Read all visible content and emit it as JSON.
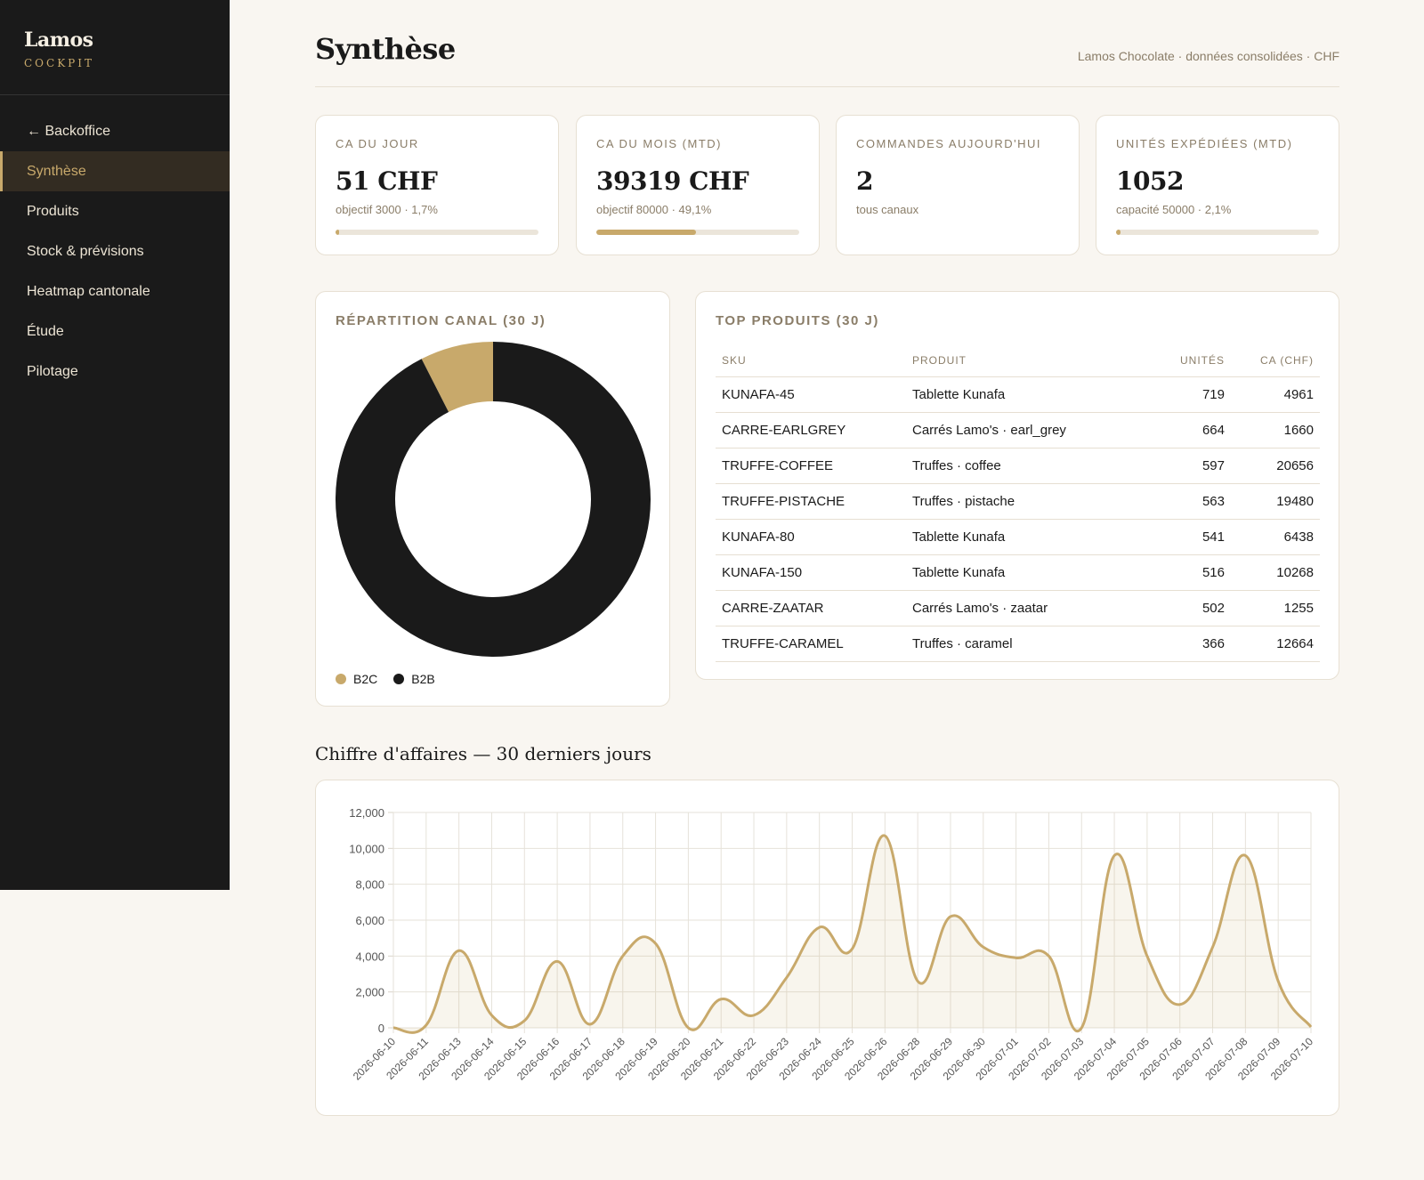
{
  "sidebar": {
    "brand": "Lamos",
    "brand_sub": "COCKPIT",
    "items": [
      {
        "label": "← Backoffice",
        "active": false
      },
      {
        "label": "Synthèse",
        "active": true
      },
      {
        "label": "Produits",
        "active": false
      },
      {
        "label": "Stock & prévisions",
        "active": false
      },
      {
        "label": "Heatmap cantonale",
        "active": false
      },
      {
        "label": "Étude",
        "active": false
      },
      {
        "label": "Pilotage",
        "active": false
      }
    ]
  },
  "header": {
    "title": "Synthèse",
    "meta": "Lamos Chocolate · données consolidées · CHF"
  },
  "kpis": [
    {
      "label": "CA du jour",
      "value": "51 CHF",
      "sub": "objectif 3000 · 1,7%",
      "progress": 0.017
    },
    {
      "label": "CA du mois (MTD)",
      "value": "39319 CHF",
      "sub": "objectif 80000 · 49,1%",
      "progress": 0.491
    },
    {
      "label": "Commandes aujourd'hui",
      "value": "2",
      "sub": "tous canaux",
      "progress": null
    },
    {
      "label": "Unités expédiées (MTD)",
      "value": "1052",
      "sub": "capacité 50000 · 2,1%",
      "progress": 0.021
    }
  ],
  "channel": {
    "title": "Répartition canal (30 j)",
    "chart_data": {
      "type": "pie",
      "labels": [
        "B2C",
        "B2B"
      ],
      "values": [
        7.5,
        92.5
      ],
      "colors": [
        "#c8a96b",
        "#1a1a1a"
      ],
      "legend": "bottom-left"
    },
    "legend": [
      {
        "label": "B2C",
        "color": "#c8a96b"
      },
      {
        "label": "B2B",
        "color": "#1a1a1a"
      }
    ]
  },
  "top_products": {
    "title": "Top produits (30 j)",
    "columns": [
      "SKU",
      "Produit",
      "Unités",
      "CA (CHF)"
    ],
    "rows": [
      [
        "KUNAFA-45",
        "Tablette Kunafa",
        "719",
        "4961"
      ],
      [
        "CARRE-EARLGREY",
        "Carrés Lamo's · earl_grey",
        "664",
        "1660"
      ],
      [
        "TRUFFE-COFFEE",
        "Truffes · coffee",
        "597",
        "20656"
      ],
      [
        "TRUFFE-PISTACHE",
        "Truffes · pistache",
        "563",
        "19480"
      ],
      [
        "KUNAFA-80",
        "Tablette Kunafa",
        "541",
        "6438"
      ],
      [
        "KUNAFA-150",
        "Tablette Kunafa",
        "516",
        "10268"
      ],
      [
        "CARRE-ZAATAR",
        "Carrés Lamo's · zaatar",
        "502",
        "1255"
      ],
      [
        "TRUFFE-CARAMEL",
        "Truffes · caramel",
        "366",
        "12664"
      ]
    ]
  },
  "revenue": {
    "title": "Chiffre d'affaires — 30 derniers jours",
    "chart_data": {
      "type": "area",
      "x": [
        "2026-06-10",
        "2026-06-11",
        "2026-06-13",
        "2026-06-14",
        "2026-06-15",
        "2026-06-16",
        "2026-06-17",
        "2026-06-18",
        "2026-06-19",
        "2026-06-20",
        "2026-06-21",
        "2026-06-22",
        "2026-06-23",
        "2026-06-24",
        "2026-06-25",
        "2026-06-26",
        "2026-06-28",
        "2026-06-29",
        "2026-06-30",
        "2026-07-01",
        "2026-07-02",
        "2026-07-03",
        "2026-07-04",
        "2026-07-05",
        "2026-07-06",
        "2026-07-07",
        "2026-07-08",
        "2026-07-09",
        "2026-07-10"
      ],
      "values": [
        0,
        150,
        4300,
        700,
        400,
        3700,
        200,
        4000,
        4700,
        0,
        1600,
        700,
        2800,
        5600,
        4400,
        10700,
        2600,
        6200,
        4500,
        3900,
        4000,
        0,
        9600,
        4000,
        1300,
        4500,
        9600,
        2600,
        50
      ],
      "ylim": [
        0,
        12000
      ],
      "yticks": [
        "0",
        "2,000",
        "4,000",
        "6,000",
        "8,000",
        "10,000",
        "12,000"
      ],
      "grid": true,
      "color": "#c8a96b"
    }
  }
}
